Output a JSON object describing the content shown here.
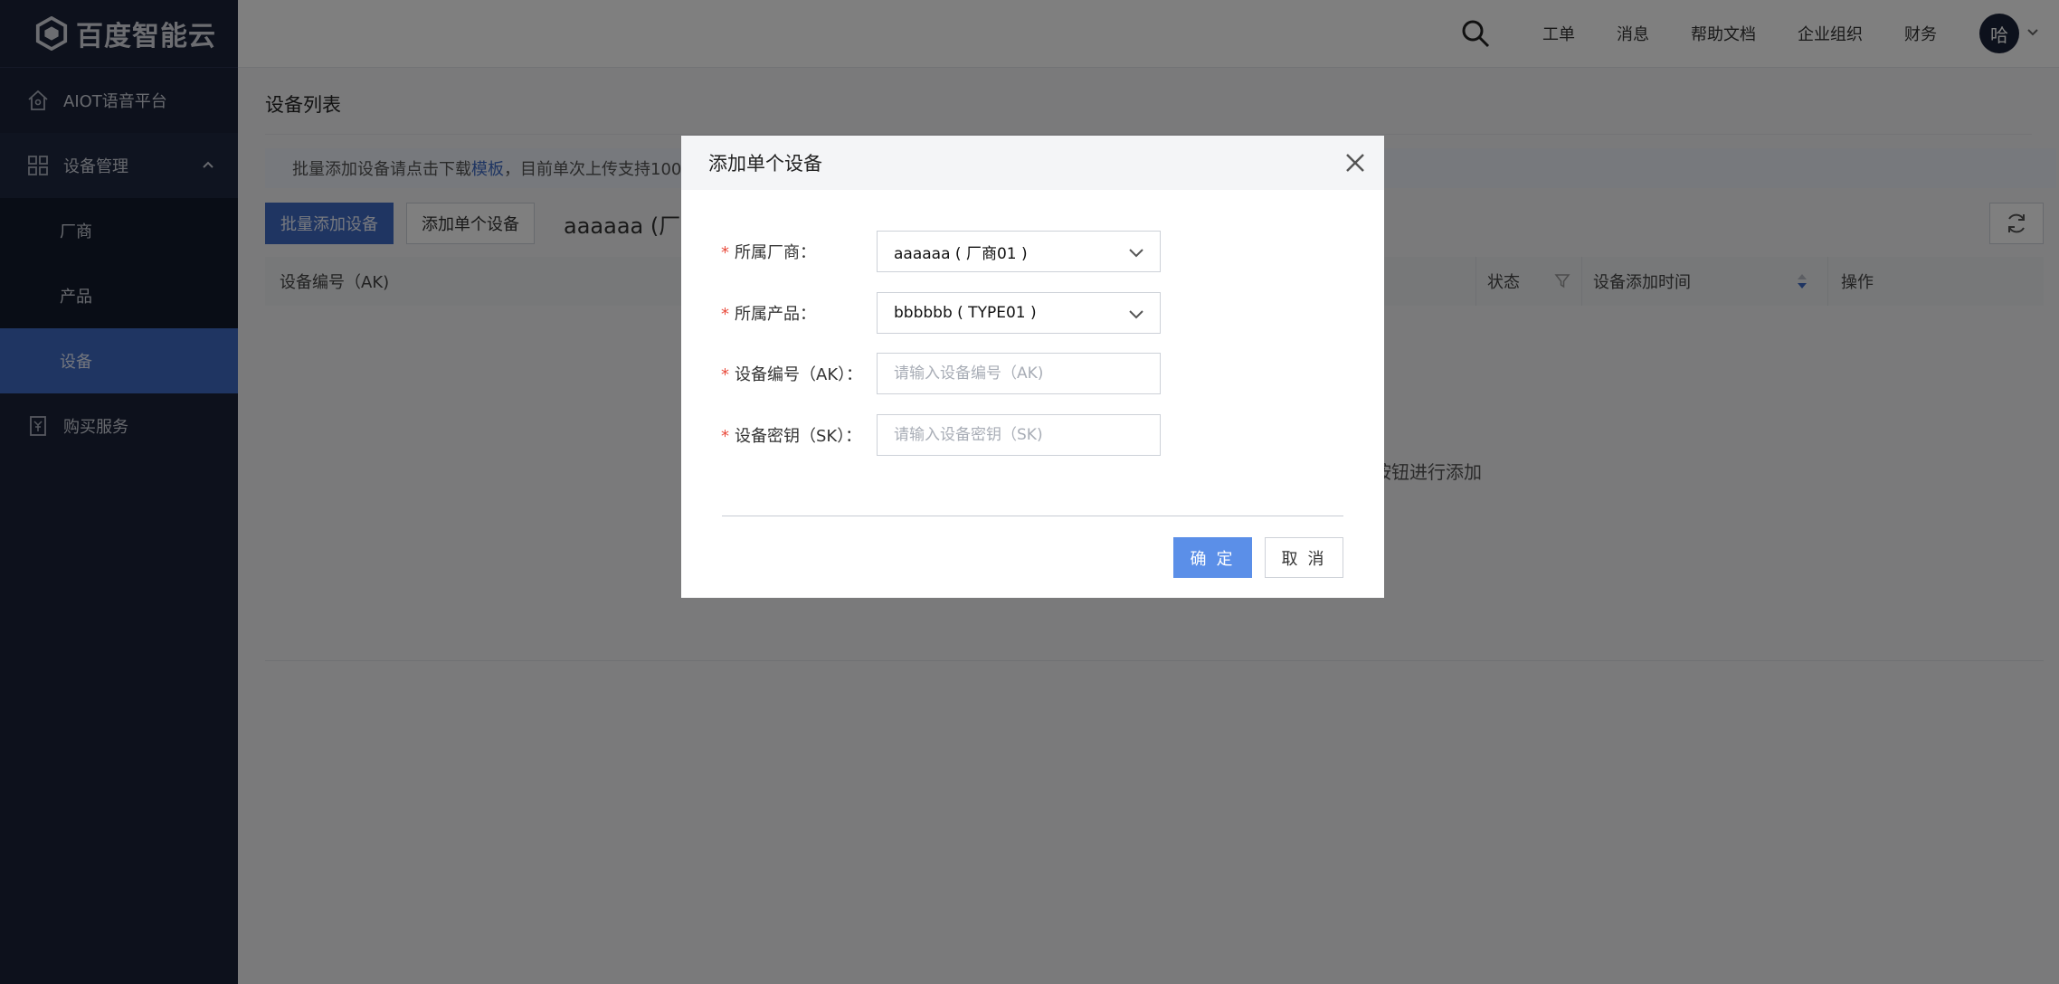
{
  "brand": {
    "name": "百度智能云"
  },
  "sidebar": {
    "items": [
      {
        "label": "AIOT语音平台",
        "icon": "home-icon"
      },
      {
        "label": "设备管理",
        "icon": "grid-icon",
        "expanded": true,
        "children": [
          {
            "label": "厂商"
          },
          {
            "label": "产品"
          },
          {
            "label": "设备",
            "active": true
          }
        ]
      },
      {
        "label": "购买服务",
        "icon": "receipt-icon"
      }
    ]
  },
  "topbar": {
    "links": [
      "工单",
      "消息",
      "帮助文档",
      "企业组织",
      "财务"
    ],
    "avatar_initial": "哈"
  },
  "main": {
    "title": "设备列表",
    "notice_prefix": "批量添加设备请点击下载",
    "notice_link": "模板",
    "notice_suffix": "，目前单次上传支持100",
    "bulk_add_label": "批量添加设备",
    "single_add_label": "添加单个设备",
    "filter_text": "aaaaaa (厂",
    "columns": [
      "设备编号（AK)",
      "状态",
      "设备添加时间",
      "操作"
    ],
    "empty_text": "按钮进行添加"
  },
  "modal": {
    "title": "添加单个设备",
    "fields": [
      {
        "label": "所属厂商：",
        "type": "select",
        "value": "aaaaaa ( 厂商01 )"
      },
      {
        "label": "所属产品：",
        "type": "select",
        "value": "bbbbbb ( TYPE01 )"
      },
      {
        "label": "设备编号（AK）：",
        "type": "input",
        "placeholder": "请输入设备编号（AK)"
      },
      {
        "label": "设备密钥（SK）：",
        "type": "input",
        "placeholder": "请输入设备密钥（SK)"
      }
    ],
    "ok_label": "确 定",
    "cancel_label": "取 消"
  },
  "colors": {
    "sidebar_bg": "#1b2338",
    "accent": "#3e6bc4",
    "ok_button": "#5b8fe8",
    "required": "#e94b3c"
  }
}
